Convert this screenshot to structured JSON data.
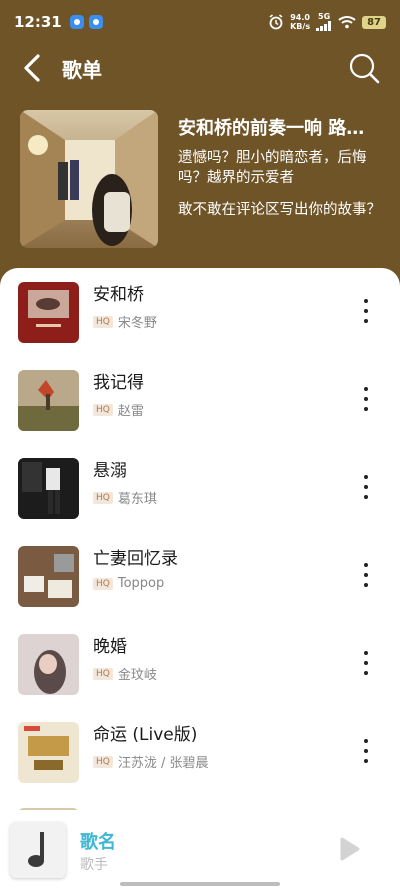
{
  "status_bar": {
    "time": "12:31",
    "net_speed_value": "94.0",
    "net_speed_unit": "KB/s",
    "network": "5G",
    "battery": "87"
  },
  "header": {
    "title": "歌单"
  },
  "playlist": {
    "name": "安和桥的前奏一响 路…",
    "description": "遗憾吗？胆小的暗恋者，后悔吗？越界的示爱者",
    "call_to_action": "敢不敢在评论区写出你的故事？"
  },
  "songs": [
    {
      "title": "安和桥",
      "badge": "HQ",
      "artist": "宋冬野"
    },
    {
      "title": "我记得",
      "badge": "HQ",
      "artist": "赵雷"
    },
    {
      "title": "悬溺",
      "badge": "HQ",
      "artist": "葛东琪"
    },
    {
      "title": "亡妻回忆录",
      "badge": "HQ",
      "artist": "Toppop"
    },
    {
      "title": "晚婚",
      "badge": "HQ",
      "artist": "金玟岐"
    },
    {
      "title": "命运 (Live版)",
      "badge": "HQ",
      "artist": "汪苏泷 / 张碧晨"
    }
  ],
  "player": {
    "song": "歌名",
    "artist": "歌手"
  },
  "colors": {
    "header_bg": "#6f5428",
    "accent": "#3fb8d4"
  }
}
